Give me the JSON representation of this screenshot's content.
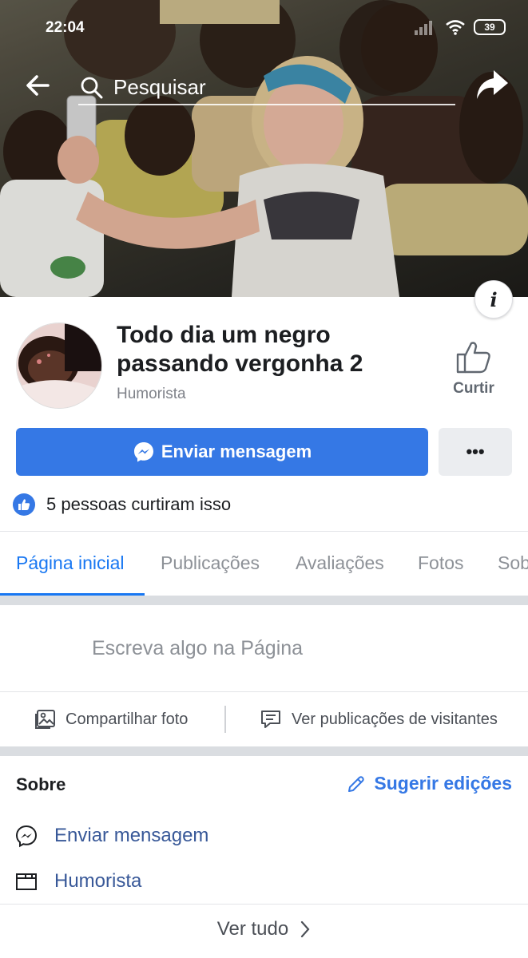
{
  "status_bar": {
    "time": "22:04",
    "battery": "39",
    "icons": [
      "signal-icon",
      "wifi-icon",
      "battery-icon"
    ]
  },
  "top_nav": {
    "search_placeholder": "Pesquisar",
    "icons": [
      "back-arrow-icon",
      "search-icon",
      "share-icon"
    ]
  },
  "page": {
    "name": "Todo dia um negro passando vergonha 2",
    "category": "Humorista",
    "like_label": "Curtir",
    "info_icon_glyph": "i"
  },
  "actions": {
    "send_message": "Enviar mensagem",
    "more": "•••",
    "likes_text": "5 pessoas curtiram isso"
  },
  "tabs": [
    {
      "label": "Página inicial",
      "active": true
    },
    {
      "label": "Publicações",
      "active": false
    },
    {
      "label": "Avaliações",
      "active": false
    },
    {
      "label": "Fotos",
      "active": false
    },
    {
      "label": "Sob",
      "active": false
    }
  ],
  "composer": {
    "placeholder": "Escreva algo na Página",
    "share_photo": "Compartilhar foto",
    "visitor_posts": "Ver publicações de visitantes"
  },
  "about": {
    "title": "Sobre",
    "suggest_edits": "Sugerir edições",
    "items": [
      {
        "icon": "messenger-icon",
        "label": "Enviar mensagem"
      },
      {
        "icon": "category-icon",
        "label": "Humorista"
      }
    ],
    "see_all": "Ver tudo"
  },
  "colors": {
    "accent": "#3578e5",
    "link": "#385898",
    "text": "#1c1e21",
    "muted": "#8d9197",
    "divider": "#dadde1"
  }
}
